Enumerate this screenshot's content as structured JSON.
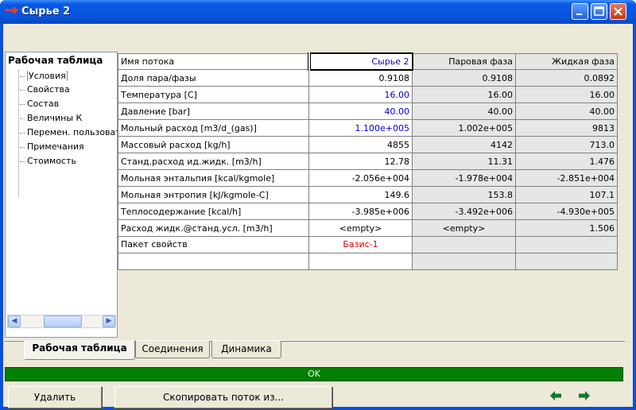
{
  "window": {
    "title": "Сырье 2"
  },
  "tree": {
    "header": "Рабочая таблица",
    "items": [
      {
        "label": "Условия",
        "selected": true
      },
      {
        "label": "Свойства",
        "selected": false
      },
      {
        "label": "Состав",
        "selected": false
      },
      {
        "label": "Величины К",
        "selected": false
      },
      {
        "label": "Перемен. пользователя",
        "selected": false
      },
      {
        "label": "Примечания",
        "selected": false
      },
      {
        "label": "Стоимость",
        "selected": false
      }
    ]
  },
  "grid": {
    "header": {
      "name": "Имя потока",
      "col1": "Сырье 2",
      "col2": "Паровая фаза",
      "col3": "Жидкая фаза"
    },
    "rows": [
      {
        "name": "Доля пара/фазы",
        "col1": "0.9108",
        "col2": "0.9108",
        "col3": "0.0892"
      },
      {
        "name": "Температура [C]",
        "col1": "16.00",
        "col2": "16.00",
        "col3": "16.00"
      },
      {
        "name": "Давление [bar]",
        "col1": "40.00",
        "col2": "40.00",
        "col3": "40.00"
      },
      {
        "name": "Мольный расход [m3/d_(gas)]",
        "col1": "1.100e+005",
        "col2": "1.002e+005",
        "col3": "9813"
      },
      {
        "name": "Массовый расход [kg/h]",
        "col1": "4855",
        "col2": "4142",
        "col3": "713.0"
      },
      {
        "name": "Станд.расход ид.жидк. [m3/h]",
        "col1": "12.78",
        "col2": "11.31",
        "col3": "1.476"
      },
      {
        "name": "Мольная энтальпия [kcal/kgmole]",
        "col1": "-2.056e+004",
        "col2": "-1.978e+004",
        "col3": "-2.851e+004"
      },
      {
        "name": "Мольная энтропия [kJ/kgmole-C]",
        "col1": "149.6",
        "col2": "153.8",
        "col3": "107.1"
      },
      {
        "name": "Теплосодержание [kcal/h]",
        "col1": "-3.985e+006",
        "col2": "-3.492e+006",
        "col3": "-4.930e+005"
      },
      {
        "name": "Расход жидк.@станд.усл. [m3/h]",
        "col1": "<empty>",
        "col2": "<empty>",
        "col3": "1.506"
      },
      {
        "name": "Пакет свойств",
        "col1": "Базис-1",
        "col2": "",
        "col3": ""
      },
      {
        "name": "",
        "col1": "",
        "col2": "",
        "col3": ""
      }
    ]
  },
  "tabs": [
    {
      "label": "Рабочая таблица",
      "active": true
    },
    {
      "label": "Соединения",
      "active": false
    },
    {
      "label": "Динамика",
      "active": false
    }
  ],
  "status": {
    "text": "OK",
    "color": "#008000"
  },
  "buttons": {
    "delete": "Удалить",
    "copy_stream": "Скопировать поток из..."
  },
  "icons": {
    "prev": "arrow-left-icon",
    "next": "arrow-right-icon",
    "scroll_left": "scroll-left-icon",
    "scroll_right": "scroll-right-icon"
  }
}
